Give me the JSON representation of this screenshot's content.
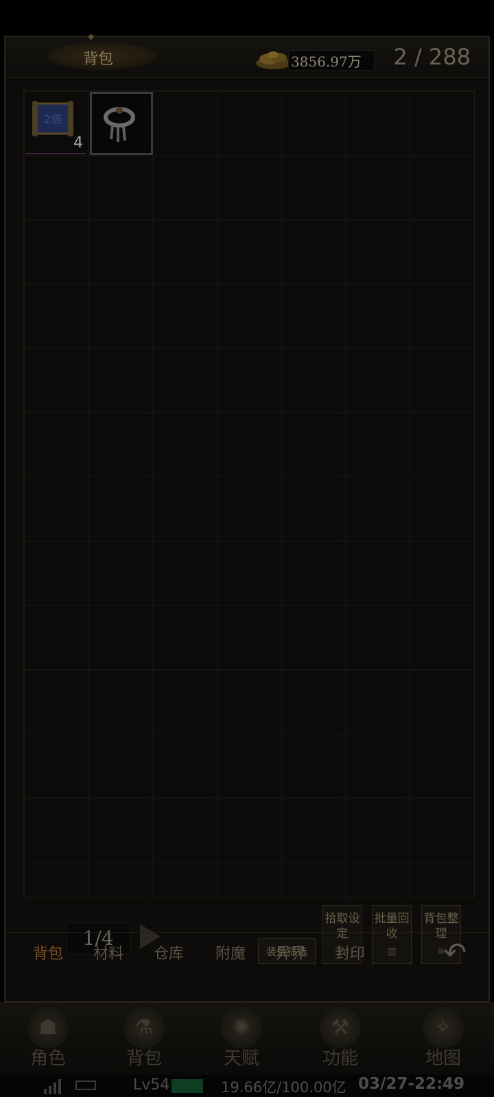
{
  "header": {
    "title": "背包",
    "gold": "3856.97万",
    "capacity": "2 / 288"
  },
  "grid": {
    "items": [
      {
        "icon": "blue-scroll-icon",
        "count": "4",
        "border_color": "#4a1d4a"
      },
      {
        "icon": "silver-ring-icon",
        "count": "",
        "border_color": "#3a3a3a"
      }
    ]
  },
  "controls": {
    "page": "1/4",
    "filter_label": "装备筛选",
    "pickup_label": "拾取设定",
    "recycle_label": "批量回收",
    "sort_label": "背包整理"
  },
  "tabs": [
    {
      "label": "背包",
      "active": true
    },
    {
      "label": "材料",
      "active": false
    },
    {
      "label": "仓库",
      "active": false
    },
    {
      "label": "附魔",
      "active": false
    },
    {
      "label": "异界",
      "active": false
    },
    {
      "label": "封印",
      "active": false
    }
  ],
  "bottom_nav": [
    {
      "label": "角色",
      "icon": "hooded-character-icon"
    },
    {
      "label": "背包",
      "icon": "potion-bag-icon"
    },
    {
      "label": "天赋",
      "icon": "dragon-emblem-icon"
    },
    {
      "label": "功能",
      "icon": "hammer-icon"
    },
    {
      "label": "地图",
      "icon": "compass-map-icon"
    }
  ],
  "status": {
    "level": "Lv54",
    "exp": "19.66亿/100.00亿",
    "datetime": "03/27-22:49"
  },
  "colors": {
    "accent_tab": "#7a4e1e",
    "xp_fill": "#0e3d22"
  }
}
